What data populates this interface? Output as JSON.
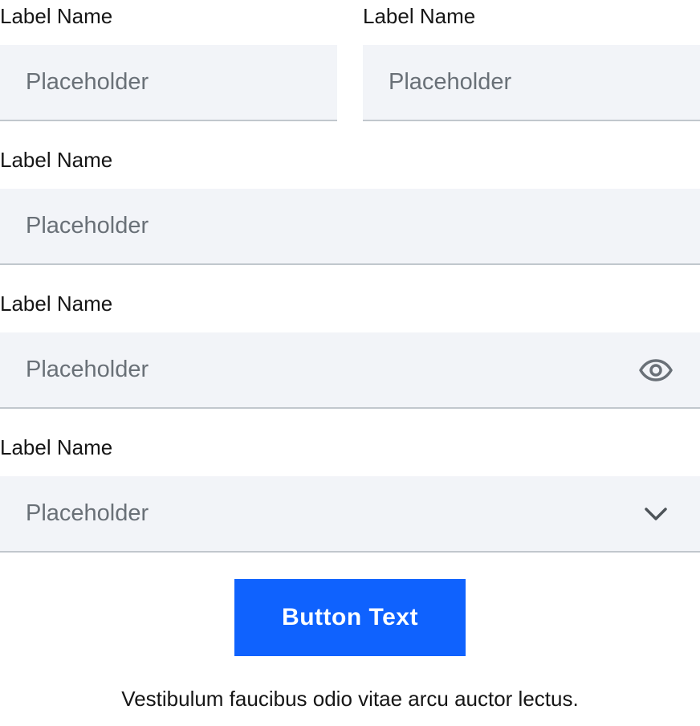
{
  "form": {
    "row1": {
      "left": {
        "label": "Label Name",
        "placeholder": "Placeholder"
      },
      "right": {
        "label": "Label Name",
        "placeholder": "Placeholder"
      }
    },
    "field2": {
      "label": "Label Name",
      "placeholder": "Placeholder"
    },
    "password": {
      "label": "Label Name",
      "placeholder": "Placeholder",
      "icon": "eye-icon"
    },
    "select": {
      "label": "Label Name",
      "value": "Placeholder",
      "icon": "chevron-down-icon"
    },
    "button": {
      "label": "Button Text"
    },
    "footnote": "Vestibulum faucibus odio vitae arcu auctor lectus."
  },
  "colors": {
    "field_background": "#f2f4f8",
    "field_border": "#c1c7cd",
    "placeholder_text": "#697077",
    "label_text": "#161616",
    "button_background": "#0f62fe",
    "button_text": "#ffffff"
  }
}
